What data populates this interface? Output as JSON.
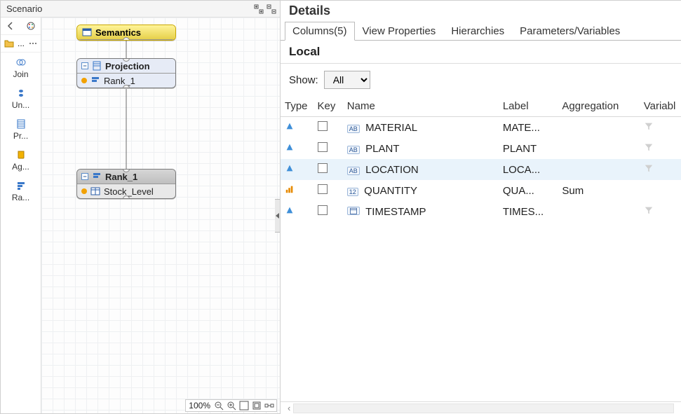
{
  "scenario": {
    "title": "Scenario",
    "header_icons": [
      "expand-tree-icon",
      "collapse-tree-icon"
    ],
    "palette_top_back_icon": "back-icon",
    "palette_top_color_icon": "palette-color-icon",
    "palette_strip": [
      {
        "icon": "folder-icon",
        "label": "..."
      },
      {
        "icon": "more-icon",
        "label": "..."
      }
    ],
    "items": [
      {
        "id": "join",
        "icon": "join-icon",
        "label": "Join"
      },
      {
        "id": "union",
        "icon": "union-icon",
        "label": "Un..."
      },
      {
        "id": "projection",
        "icon": "projection-icon",
        "label": "Pr..."
      },
      {
        "id": "aggregation",
        "icon": "aggregation-icon",
        "label": "Ag..."
      },
      {
        "id": "rank",
        "icon": "rank-icon",
        "label": "Ra..."
      }
    ],
    "nodes": {
      "semantics": {
        "title": "Semantics",
        "icon": "semantics-icon",
        "selected": true
      },
      "projection": {
        "title": "Projection",
        "icon": "projection-icon",
        "sub": {
          "bullet": "orange",
          "icon": "rank-icon",
          "label": "Rank_1"
        }
      },
      "rank1": {
        "title": "Rank_1",
        "icon": "rank-icon",
        "sub": {
          "bullet": "orange",
          "icon": "table-icon",
          "label": "Stock_Level"
        }
      }
    },
    "footer": {
      "zoom": "100%",
      "icons": [
        "zoom-out-icon",
        "zoom-in-icon",
        "fit-icon",
        "actual-size-icon",
        "layout-icon"
      ]
    }
  },
  "details": {
    "title": "Details",
    "tabs": [
      {
        "id": "columns",
        "label": "Columns(5)",
        "active": true
      },
      {
        "id": "viewprops",
        "label": "View Properties",
        "active": false
      },
      {
        "id": "hierarchies",
        "label": "Hierarchies",
        "active": false
      },
      {
        "id": "params",
        "label": "Parameters/Variables",
        "active": false
      }
    ],
    "panel": {
      "section_title": "Local",
      "show_label": "Show:",
      "show_value": "All",
      "show_options": [
        "All"
      ],
      "columns": [
        {
          "id": "type",
          "label": "Type"
        },
        {
          "id": "key",
          "label": "Key"
        },
        {
          "id": "name",
          "label": "Name"
        },
        {
          "id": "label",
          "label": "Label"
        },
        {
          "id": "aggregation",
          "label": "Aggregation"
        },
        {
          "id": "variable",
          "label": "Variabl"
        }
      ],
      "rows": [
        {
          "type": "attribute",
          "type_icon": "attr-icon",
          "key": false,
          "dtype": "AB",
          "name": "MATERIAL",
          "label": "MATE...",
          "aggregation": "",
          "variable_filter": true,
          "selected": false
        },
        {
          "type": "attribute",
          "type_icon": "attr-icon",
          "key": false,
          "dtype": "AB",
          "name": "PLANT",
          "label": "PLANT",
          "aggregation": "",
          "variable_filter": true,
          "selected": false
        },
        {
          "type": "attribute",
          "type_icon": "attr-icon",
          "key": false,
          "dtype": "AB",
          "name": "LOCATION",
          "label": "LOCA...",
          "aggregation": "",
          "variable_filter": true,
          "selected": true
        },
        {
          "type": "measure",
          "type_icon": "measure-icon",
          "key": false,
          "dtype": "12",
          "name": "QUANTITY",
          "label": "QUA...",
          "aggregation": "Sum",
          "variable_filter": false,
          "selected": false
        },
        {
          "type": "attribute",
          "type_icon": "attr-icon",
          "key": false,
          "dtype": "TS",
          "name": "TIMESTAMP",
          "label": "TIMES...",
          "aggregation": "",
          "variable_filter": true,
          "selected": false
        }
      ]
    }
  }
}
